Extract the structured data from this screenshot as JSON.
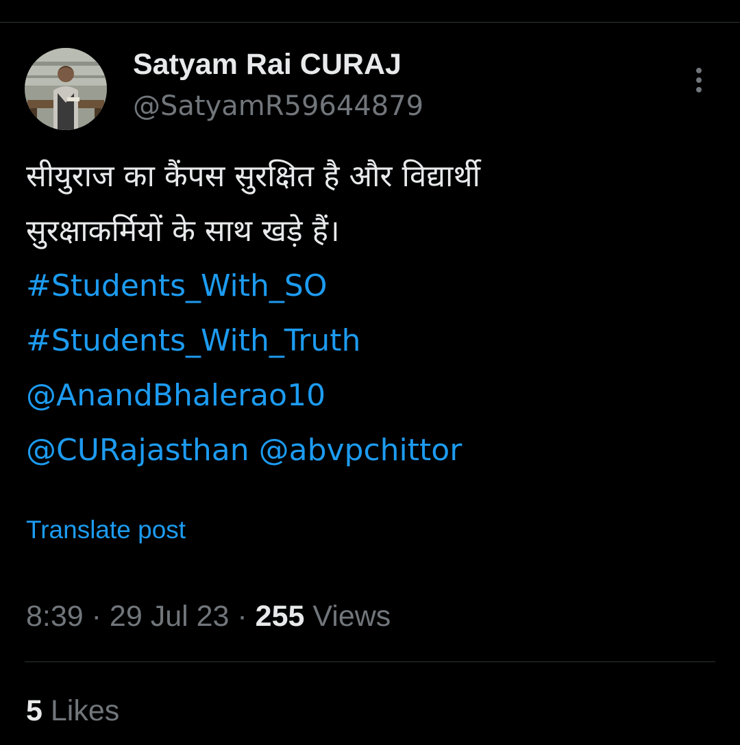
{
  "author": {
    "display_name": "Satyam Rai CURAJ",
    "handle": "@SatyamR59644879"
  },
  "post": {
    "text_line_1": "सीयुराज का कैंपस सुरक्षित है और विद्यार्थी",
    "text_line_2": "सुरक्षाकर्मियों के साथ खड़े हैं।",
    "hashtag_1": "#Students_With_SO",
    "hashtag_2": "#Students_With_Truth",
    "mention_1": "@AnandBhalerao10",
    "mention_2": "@CURajasthan",
    "mention_3": "@abvpchittor"
  },
  "translate_label": "Translate post",
  "meta": {
    "time": "8:39",
    "separator": " · ",
    "date": "29 Jul 23",
    "views_count": "255",
    "views_label": " Views"
  },
  "engagement": {
    "likes_count": "5",
    "likes_label": " Likes"
  },
  "colors": {
    "background": "#000000",
    "primary_text": "#e7e9ea",
    "secondary_text": "#71767b",
    "link": "#1d9bf0",
    "divider": "#2f3336"
  },
  "icons": {
    "more": "more-vertical-icon"
  }
}
